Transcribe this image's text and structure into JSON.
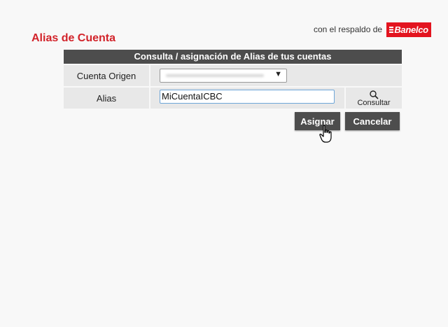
{
  "page": {
    "title": "Alias de Cuenta",
    "brand_prefix": "con el respaldo de",
    "brand_name": "Banelco"
  },
  "panel": {
    "header": "Consulta / asignación de Alias de tus cuentas",
    "origin_label": "Cuenta Origen",
    "origin_value": "",
    "alias_label": "Alias",
    "alias_value": "MiCuentaICBC",
    "consult_label": "Consultar"
  },
  "actions": {
    "assign_label": "Asignar",
    "cancel_label": "Cancelar"
  },
  "colors": {
    "title_red": "#d2232a",
    "brand_red": "#e3141f",
    "header_gray": "#4d4d4d",
    "row_gray": "#e8e8e8"
  },
  "icons": {
    "consult": "search-icon",
    "select_arrow": "dropdown-arrow-icon",
    "cursor": "hand-pointer-icon"
  }
}
